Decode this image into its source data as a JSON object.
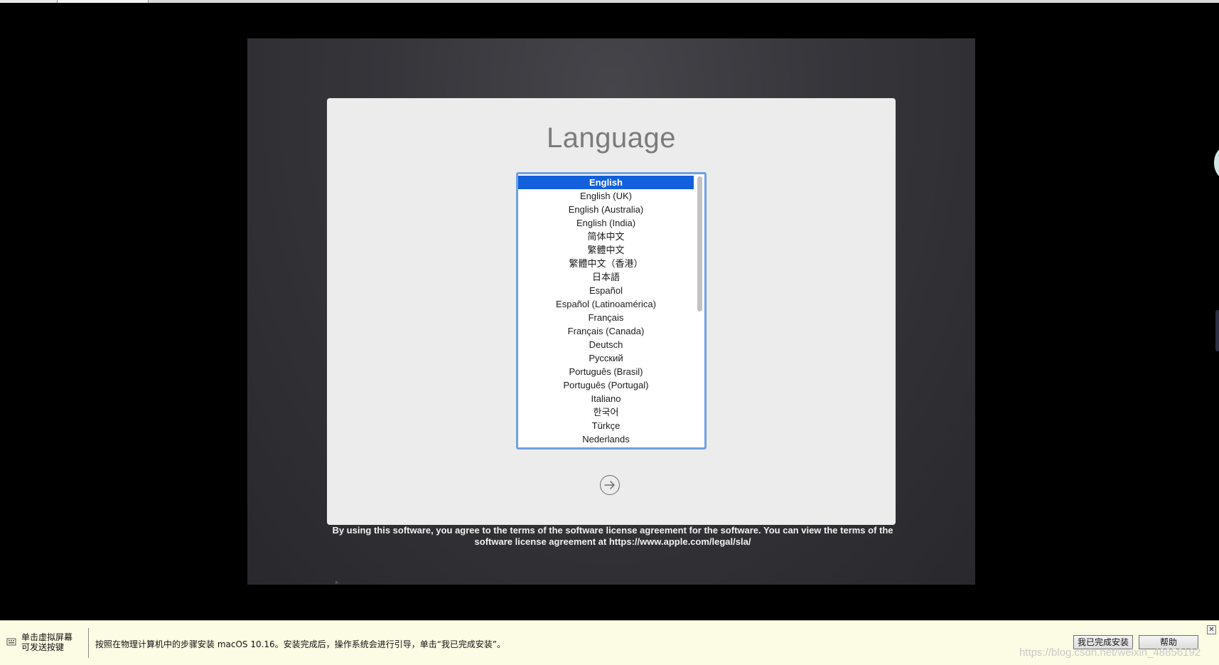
{
  "installer": {
    "title": "Language",
    "languages": [
      "English",
      "English (UK)",
      "English (Australia)",
      "English (India)",
      "简体中文",
      "繁體中文",
      "繁體中文（香港）",
      "日本語",
      "Español",
      "Español (Latinoamérica)",
      "Français",
      "Français (Canada)",
      "Deutsch",
      "Русский",
      "Português (Brasil)",
      "Português (Portugal)",
      "Italiano",
      "한국어",
      "Türkçe",
      "Nederlands"
    ],
    "selected_index": 0,
    "license_text": "By using this software, you agree to the terms of the software license agreement for the software. You can view the terms of the software license agreement at https://www.apple.com/legal/sla/"
  },
  "hint_bar": {
    "left_text": "单击虚拟屏幕\n可发送按键",
    "message": "按照在物理计算机中的步骤安装 macOS 10.16。安装完成后，操作系统会进行引导，单击“我已完成安装”。",
    "done_button": "我已完成安装",
    "help_button": "帮助",
    "close_label": "✕",
    "watermark": "https://blog.csdn.net/weixin_48856192"
  },
  "icons": {
    "next": "arrow-right-circle-icon",
    "hint": "keyboard-icon",
    "close": "close-icon"
  },
  "colors": {
    "selection": "#1360dc",
    "list_border": "#6fa1e2",
    "hint_background": "#fcfbe3"
  }
}
